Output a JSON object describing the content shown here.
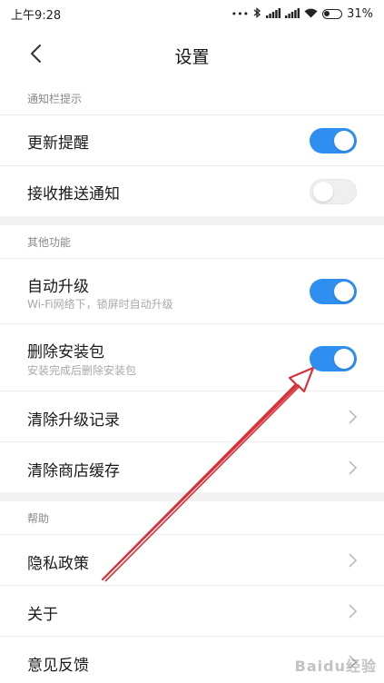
{
  "status_bar": {
    "time": "上午9:28",
    "battery": "31%",
    "icons": [
      "more-dots-icon",
      "bluetooth-icon",
      "signal-icon",
      "signal-icon",
      "wifi-icon",
      "battery-icon"
    ]
  },
  "header": {
    "title": "设置"
  },
  "sections": {
    "notify": {
      "title": "通知栏提示",
      "update_reminder": {
        "label": "更新提醒",
        "on": true
      },
      "push_notice": {
        "label": "接收推送通知",
        "on": false
      }
    },
    "other": {
      "title": "其他功能",
      "auto_upgrade": {
        "label": "自动升级",
        "sub": "Wi-Fi网络下，锁屏时自动升级",
        "on": true
      },
      "delete_package": {
        "label": "删除安装包",
        "sub": "安装完成后删除安装包",
        "on": true
      },
      "clear_upgrade_record": {
        "label": "清除升级记录"
      },
      "clear_store_cache": {
        "label": "清除商店缓存"
      }
    },
    "help": {
      "title": "帮助",
      "privacy": {
        "label": "隐私政策"
      },
      "about": {
        "label": "关于"
      },
      "feedback": {
        "label": "意见反馈"
      }
    }
  },
  "watermark": "Baidu经验",
  "colors": {
    "toggle_on": "#2f8ff0",
    "annotation_arrow": "#d8323c"
  }
}
